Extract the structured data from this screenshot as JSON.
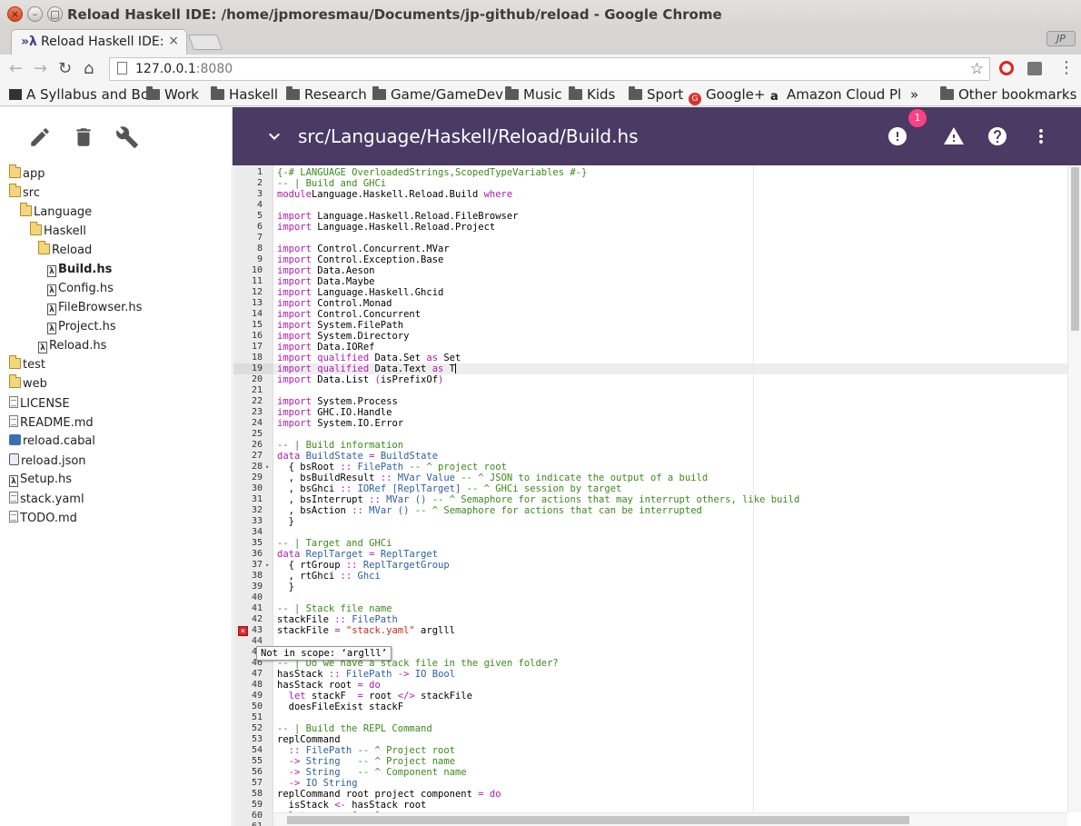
{
  "window": {
    "title": "Reload Haskell IDE: /home/jpmoresmau/Documents/jp-github/reload - Google Chrome"
  },
  "tab": {
    "favicon": "haskell-icon",
    "label": "Reload Haskell IDE:",
    "close": "×"
  },
  "profile": "JP",
  "omnibox": {
    "host": "127.0.0.1",
    "port": ":8080"
  },
  "bookmarks": [
    {
      "label": "A Syllabus and Bo",
      "icon": "page-icon"
    },
    {
      "label": "Work",
      "icon": "folder-icon"
    },
    {
      "label": "Haskell",
      "icon": "folder-icon"
    },
    {
      "label": "Research",
      "icon": "folder-icon"
    },
    {
      "label": "Game/GameDev",
      "icon": "folder-icon"
    },
    {
      "label": "Music",
      "icon": "folder-icon"
    },
    {
      "label": "Kids",
      "icon": "folder-icon"
    },
    {
      "label": "Sport",
      "icon": "folder-icon"
    },
    {
      "label": "Google+",
      "icon": "google-icon"
    },
    {
      "label": "Amazon Cloud Pl",
      "icon": "amazon-icon"
    },
    {
      "label": "»",
      "icon": ""
    },
    {
      "label": "Other bookmarks",
      "icon": "folder-icon"
    }
  ],
  "sidebar": {
    "tools": [
      "edit-icon",
      "delete-icon",
      "wrench-icon"
    ],
    "tree": [
      {
        "label": "app",
        "type": "folder",
        "depth": 0
      },
      {
        "label": "src",
        "type": "folder",
        "depth": 0
      },
      {
        "label": "Language",
        "type": "folder",
        "depth": 1
      },
      {
        "label": "Haskell",
        "type": "folder",
        "depth": 2
      },
      {
        "label": "Reload",
        "type": "folder",
        "depth": 3
      },
      {
        "label": "Build.hs",
        "type": "hs",
        "depth": 4,
        "selected": true
      },
      {
        "label": "Config.hs",
        "type": "hs",
        "depth": 4
      },
      {
        "label": "FileBrowser.hs",
        "type": "hs",
        "depth": 4
      },
      {
        "label": "Project.hs",
        "type": "hs",
        "depth": 4
      },
      {
        "label": "Reload.hs",
        "type": "hs",
        "depth": 3
      },
      {
        "label": "test",
        "type": "folder",
        "depth": 0
      },
      {
        "label": "web",
        "type": "folder",
        "depth": 0
      },
      {
        "label": "LICENSE",
        "type": "file",
        "depth": 0
      },
      {
        "label": "README.md",
        "type": "file",
        "depth": 0
      },
      {
        "label": "reload.cabal",
        "type": "cabal",
        "depth": 0
      },
      {
        "label": "reload.json",
        "type": "json",
        "depth": 0
      },
      {
        "label": "Setup.hs",
        "type": "hs",
        "depth": 0
      },
      {
        "label": "stack.yaml",
        "type": "file",
        "depth": 0
      },
      {
        "label": "TODO.md",
        "type": "file",
        "depth": 0
      }
    ]
  },
  "header": {
    "path": "src/Language/Haskell/Reload/Build.hs",
    "error_count": "1",
    "color": "#4a3a64",
    "badge_color": "#ff4081"
  },
  "editor": {
    "current_line": 19,
    "error_line": 43,
    "fold_lines": [
      28,
      37
    ],
    "tooltip": "Not in scope: ‘arglll’",
    "lines": [
      [
        [
          "cm",
          "{-# LANGUAGE OverloadedStrings,ScopedTypeVariables #-}"
        ]
      ],
      [
        [
          "cm",
          "-- | Build and GHCi"
        ]
      ],
      [
        [
          "kw",
          "module"
        ],
        [
          "",
          "Language.Haskell.Reload.Build "
        ],
        [
          "kw",
          "where"
        ]
      ],
      [],
      [
        [
          "kw",
          "import"
        ],
        [
          "",
          " Language.Haskell.Reload.FileBrowser"
        ]
      ],
      [
        [
          "kw",
          "import"
        ],
        [
          "",
          " Language.Haskell.Reload.Project"
        ]
      ],
      [],
      [
        [
          "kw",
          "import"
        ],
        [
          "",
          " Control.Concurrent.MVar"
        ]
      ],
      [
        [
          "kw",
          "import"
        ],
        [
          "",
          " Control.Exception.Base"
        ]
      ],
      [
        [
          "kw",
          "import"
        ],
        [
          "",
          " Data.Aeson"
        ]
      ],
      [
        [
          "kw",
          "import"
        ],
        [
          "",
          " Data.Maybe"
        ]
      ],
      [
        [
          "kw",
          "import"
        ],
        [
          "",
          " Language.Haskell.Ghcid"
        ]
      ],
      [
        [
          "kw",
          "import"
        ],
        [
          "",
          " Control.Monad"
        ]
      ],
      [
        [
          "kw",
          "import"
        ],
        [
          "",
          " Control.Concurrent"
        ]
      ],
      [
        [
          "kw",
          "import"
        ],
        [
          "",
          " System.FilePath"
        ]
      ],
      [
        [
          "kw",
          "import"
        ],
        [
          "",
          " System.Directory"
        ]
      ],
      [
        [
          "kw",
          "import"
        ],
        [
          "",
          " Data.IORef"
        ]
      ],
      [
        [
          "kw",
          "import qualified"
        ],
        [
          "",
          " Data.Set "
        ],
        [
          "kw",
          "as"
        ],
        [
          "",
          " Set"
        ]
      ],
      [
        [
          "kw",
          "import qualified"
        ],
        [
          "",
          " Data.Text "
        ],
        [
          "kw",
          "as"
        ],
        [
          "",
          " T"
        ]
      ],
      [
        [
          "kw",
          "import"
        ],
        [
          "",
          " Data.List "
        ],
        [
          "kw",
          "("
        ],
        [
          "",
          "isPrefixOf"
        ],
        [
          "kw",
          ")"
        ]
      ],
      [],
      [
        [
          "kw",
          "import"
        ],
        [
          "",
          " System.Process"
        ]
      ],
      [
        [
          "kw",
          "import"
        ],
        [
          "",
          " GHC.IO.Handle"
        ]
      ],
      [
        [
          "kw",
          "import"
        ],
        [
          "",
          " System.IO.Error"
        ]
      ],
      [],
      [
        [
          "cm",
          "-- | Build information"
        ]
      ],
      [
        [
          "kw",
          "data"
        ],
        [
          "",
          " "
        ],
        [
          "ty",
          "BuildState"
        ],
        [
          "",
          " "
        ],
        [
          "op",
          "="
        ],
        [
          "",
          " "
        ],
        [
          "ty",
          "BuildState"
        ]
      ],
      [
        [
          "",
          "  { bsRoot "
        ],
        [
          "op",
          "::"
        ],
        [
          "",
          " "
        ],
        [
          "ty",
          "FilePath"
        ],
        [
          "",
          " "
        ],
        [
          "cm",
          "-- ^ project root"
        ]
      ],
      [
        [
          "",
          "  , bsBuildResult "
        ],
        [
          "op",
          "::"
        ],
        [
          "",
          " "
        ],
        [
          "ty",
          "MVar Value"
        ],
        [
          "",
          " "
        ],
        [
          "cm",
          "-- ^ JSON to indicate the output of a build"
        ]
      ],
      [
        [
          "",
          "  , bsGhci "
        ],
        [
          "op",
          "::"
        ],
        [
          "",
          " "
        ],
        [
          "ty",
          "IORef"
        ],
        [
          "",
          " "
        ],
        [
          "ty",
          "[ReplTarget]"
        ],
        [
          "",
          " "
        ],
        [
          "cm",
          "-- ^ GHCi session by target"
        ]
      ],
      [
        [
          "",
          "  , bsInterrupt "
        ],
        [
          "op",
          "::"
        ],
        [
          "",
          " "
        ],
        [
          "ty",
          "MVar ()"
        ],
        [
          "",
          " "
        ],
        [
          "cm",
          "-- ^ Semaphore for actions that may interrupt others, like build"
        ]
      ],
      [
        [
          "",
          "  , bsAction "
        ],
        [
          "op",
          "::"
        ],
        [
          "",
          " "
        ],
        [
          "ty",
          "MVar ()"
        ],
        [
          "",
          " "
        ],
        [
          "cm",
          "-- ^ Semaphore for actions that can be interrupted"
        ]
      ],
      [
        [
          "",
          "  }"
        ]
      ],
      [],
      [
        [
          "cm",
          "-- | Target and GHCi"
        ]
      ],
      [
        [
          "kw",
          "data"
        ],
        [
          "",
          " "
        ],
        [
          "ty",
          "ReplTarget"
        ],
        [
          "",
          " "
        ],
        [
          "op",
          "="
        ],
        [
          "",
          " "
        ],
        [
          "ty",
          "ReplTarget"
        ]
      ],
      [
        [
          "",
          "  { rtGroup "
        ],
        [
          "op",
          "::"
        ],
        [
          "",
          " "
        ],
        [
          "ty",
          "ReplTargetGroup"
        ]
      ],
      [
        [
          "",
          "  , rtGhci "
        ],
        [
          "op",
          "::"
        ],
        [
          "",
          " "
        ],
        [
          "ty",
          "Ghci"
        ]
      ],
      [
        [
          "",
          "  }"
        ]
      ],
      [],
      [
        [
          "cm",
          "-- | Stack file name"
        ]
      ],
      [
        [
          "",
          "stackFile "
        ],
        [
          "op",
          "::"
        ],
        [
          "",
          " "
        ],
        [
          "ty",
          "FilePath"
        ]
      ],
      [
        [
          "",
          "stackFile "
        ],
        [
          "op",
          "="
        ],
        [
          "",
          " "
        ],
        [
          "st",
          "\"stack.yaml\""
        ],
        [
          "",
          " arglll"
        ]
      ],
      [],
      [],
      [
        [
          "cm",
          "-- | Do we have a stack file in the given folder?"
        ]
      ],
      [
        [
          "",
          "hasStack "
        ],
        [
          "op",
          "::"
        ],
        [
          "",
          " "
        ],
        [
          "ty",
          "FilePath"
        ],
        [
          "",
          " "
        ],
        [
          "op",
          "->"
        ],
        [
          "",
          " "
        ],
        [
          "ty",
          "IO Bool"
        ]
      ],
      [
        [
          "",
          "hasStack root "
        ],
        [
          "op",
          "="
        ],
        [
          "",
          " "
        ],
        [
          "kw",
          "do"
        ]
      ],
      [
        [
          "",
          "  "
        ],
        [
          "kw",
          "let"
        ],
        [
          "",
          " stackF  "
        ],
        [
          "op",
          "="
        ],
        [
          "",
          " root "
        ],
        [
          "op",
          "</>"
        ],
        [
          "",
          " stackFile"
        ]
      ],
      [
        [
          "",
          "  doesFileExist stackF"
        ]
      ],
      [],
      [
        [
          "cm",
          "-- | Build the REPL Command"
        ]
      ],
      [
        [
          "",
          "replCommand"
        ]
      ],
      [
        [
          "",
          "  "
        ],
        [
          "op",
          "::"
        ],
        [
          "",
          " "
        ],
        [
          "ty",
          "FilePath"
        ],
        [
          "",
          " "
        ],
        [
          "cm",
          "-- ^ Project root"
        ]
      ],
      [
        [
          "",
          "  "
        ],
        [
          "op",
          "->"
        ],
        [
          "",
          " "
        ],
        [
          "ty",
          "String"
        ],
        [
          "",
          "   "
        ],
        [
          "cm",
          "-- ^ Project name"
        ]
      ],
      [
        [
          "",
          "  "
        ],
        [
          "op",
          "->"
        ],
        [
          "",
          " "
        ],
        [
          "ty",
          "String"
        ],
        [
          "",
          "   "
        ],
        [
          "cm",
          "-- ^ Component name"
        ]
      ],
      [
        [
          "",
          "  "
        ],
        [
          "op",
          "->"
        ],
        [
          "",
          " "
        ],
        [
          "ty",
          "IO String"
        ]
      ],
      [
        [
          "",
          "replCommand root project component "
        ],
        [
          "op",
          "="
        ],
        [
          "",
          " "
        ],
        [
          "kw",
          "do"
        ]
      ],
      [
        [
          "",
          "  isStack "
        ],
        [
          "op",
          "<-"
        ],
        [
          "",
          " hasStack root"
        ]
      ],
      [
        [
          "",
          "  "
        ],
        [
          "kw",
          "let"
        ],
        [
          "",
          " args "
        ],
        [
          "op",
          "="
        ],
        [
          "",
          " "
        ],
        [
          "ty",
          "[...]"
        ]
      ],
      [
        [
          "",
          ""
        ]
      ]
    ]
  }
}
